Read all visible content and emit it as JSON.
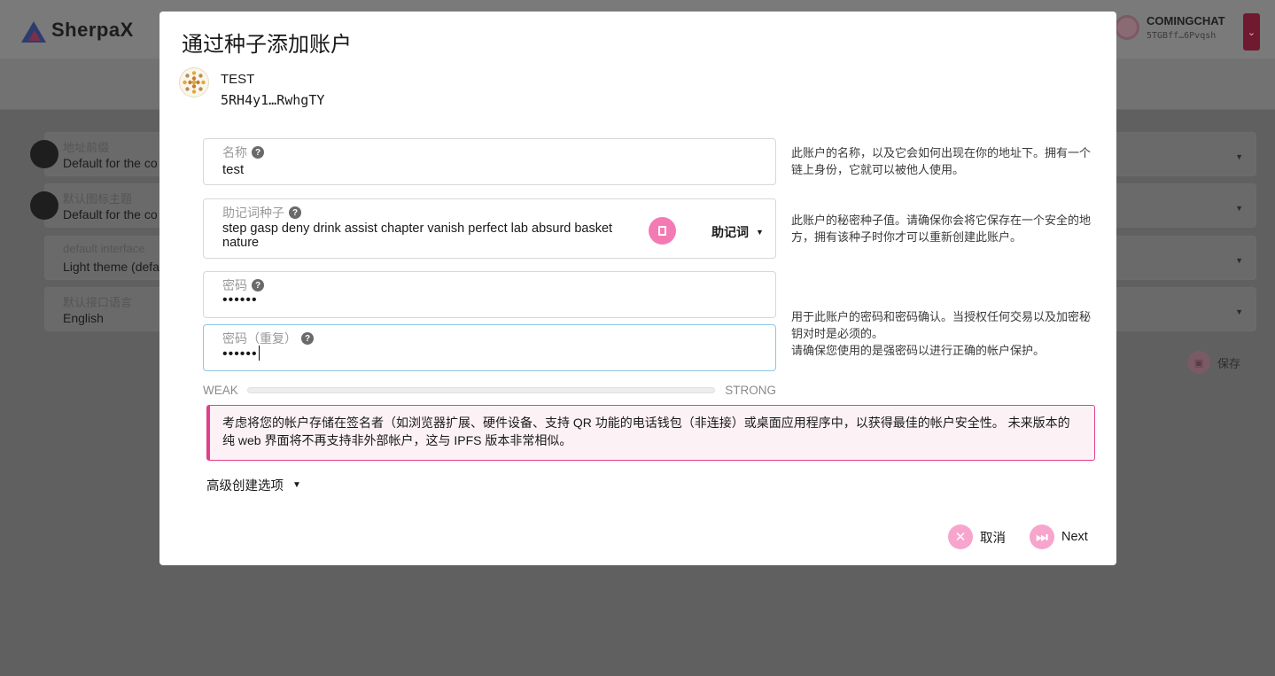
{
  "background": {
    "logo_text": "SherpaX",
    "account_name": "COMINGCHAT",
    "account_address": "5TGBff…6Pvqsh",
    "settings": [
      {
        "label": "地址前缀",
        "value": "Default for the co"
      },
      {
        "label": "默认图标主题",
        "value": "Default for the co"
      },
      {
        "label": "default interface",
        "value": "Light theme (defa"
      },
      {
        "label": "默认接口语言",
        "value": "English"
      }
    ],
    "save_label": "保存"
  },
  "modal": {
    "title": "通过种子添加账户",
    "account": {
      "name": "TEST",
      "address": "5RH4y1…RwhgTY"
    },
    "fields": {
      "name": {
        "label": "名称",
        "value": "test"
      },
      "seed": {
        "label": "助记词种子",
        "value": "step gasp deny drink assist chapter vanish perfect lab absurd basket nature",
        "type_label": "助记词"
      },
      "password": {
        "label": "密码",
        "value": "••••••"
      },
      "password_repeat": {
        "label": "密码（重复）",
        "value": "••••••"
      }
    },
    "hints": {
      "name": "此账户的名称，以及它会如何出现在你的地址下。拥有一个链上身份，它就可以被他人使用。",
      "seed": "此账户的秘密种子值。请确保你会将它保存在一个安全的地方，拥有该种子时你才可以重新创建此账户。",
      "password_1": "用于此账户的密码和密码确认。当授权任何交易以及加密秘钥对时是必须的。",
      "password_2": "请确保您使用的是强密码以进行正确的帐户保护。"
    },
    "strength": {
      "weak": "WEAK",
      "strong": "STRONG",
      "level": 0
    },
    "warning": "考虑将您的帐户存储在签名者（如浏览器扩展、硬件设备、支持 QR 功能的电话钱包（非连接）或桌面应用程序中，以获得最佳的帐户安全性。 未来版本的纯 web 界面将不再支持非外部帐户，这与 IPFS 版本非常相似。",
    "advanced_label": "高级创建选项",
    "cancel_label": "取消",
    "next_label": "Next"
  },
  "colors": {
    "accent": "#f47ab4",
    "warning_border": "#e0408c",
    "overlay": "#5f5f5f"
  }
}
